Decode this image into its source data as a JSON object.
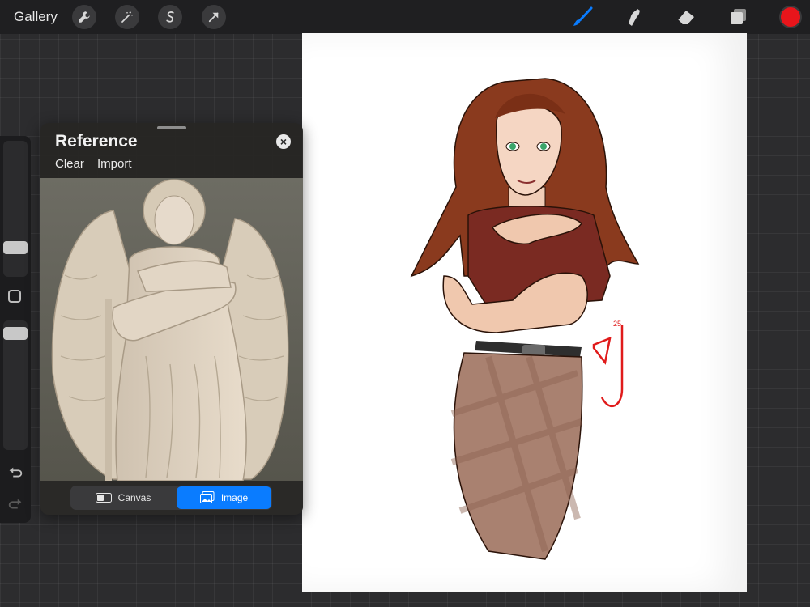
{
  "topbar": {
    "gallery_label": "Gallery",
    "left_tools": [
      "wrench-icon",
      "magic-wand-icon",
      "selection-s-icon",
      "transform-arrow-icon"
    ],
    "right_tools": [
      "brush-icon",
      "smudge-icon",
      "eraser-icon",
      "layers-icon"
    ],
    "active_tool": "brush-icon",
    "current_color": "#e8151b",
    "accent_color": "#0a7cff"
  },
  "sidebar": {
    "controls": [
      "brush-size-slider",
      "modify-button",
      "opacity-slider",
      "undo-icon",
      "redo-icon"
    ]
  },
  "reference": {
    "title": "Reference",
    "clear_label": "Clear",
    "import_label": "Import",
    "mode_canvas_label": "Canvas",
    "mode_image_label": "Image",
    "active_mode": "Image"
  },
  "canvas": {
    "signature_text": "25"
  }
}
